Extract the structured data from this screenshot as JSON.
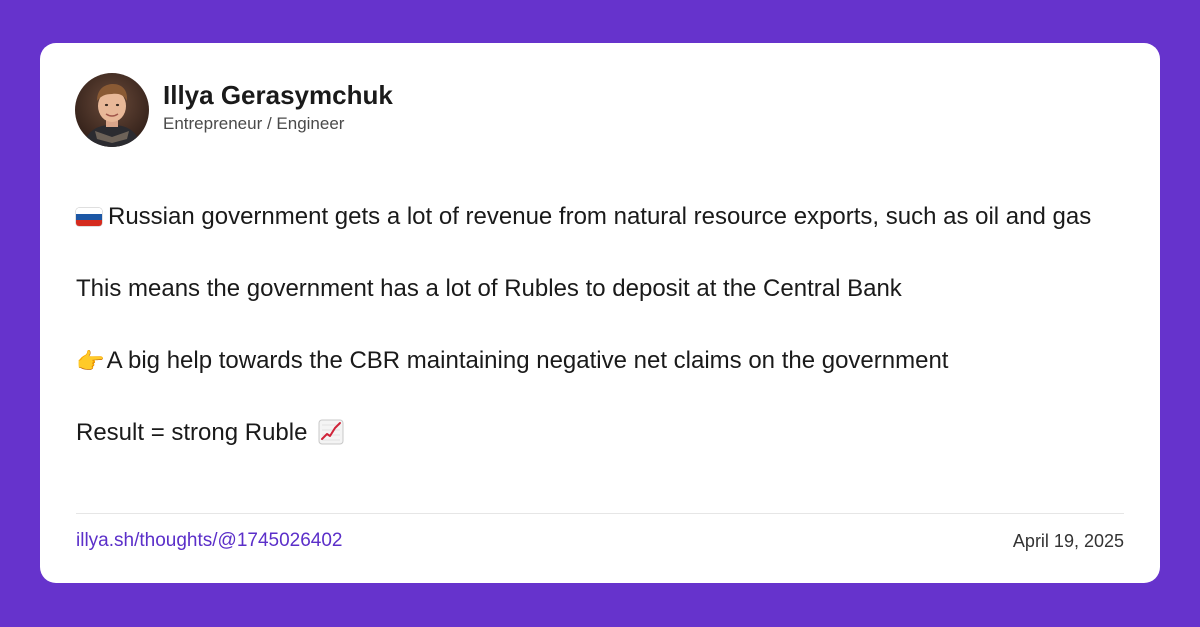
{
  "author": {
    "name": "Illya Gerasymchuk",
    "role": "Entrepreneur / Engineer"
  },
  "post": {
    "paragraphs": [
      "Russian government gets a lot of revenue from natural resource exports, such as oil and gas",
      "This means the government has a lot of Rubles to deposit at the Central Bank",
      "A big help towards the CBR maintaining negative net claims on the government",
      "Result = strong Ruble"
    ],
    "icons": {
      "p1_prefix": "russia-flag-icon",
      "p3_prefix": "pointing-hand-icon",
      "p4_suffix": "chart-increasing-icon"
    }
  },
  "footer": {
    "link": "illya.sh/thoughts/@1745026402",
    "date": "April 19, 2025"
  },
  "colors": {
    "background": "#6633cc",
    "card": "#ffffff",
    "link": "#5b2fc9",
    "text": "#1a1a1a"
  }
}
